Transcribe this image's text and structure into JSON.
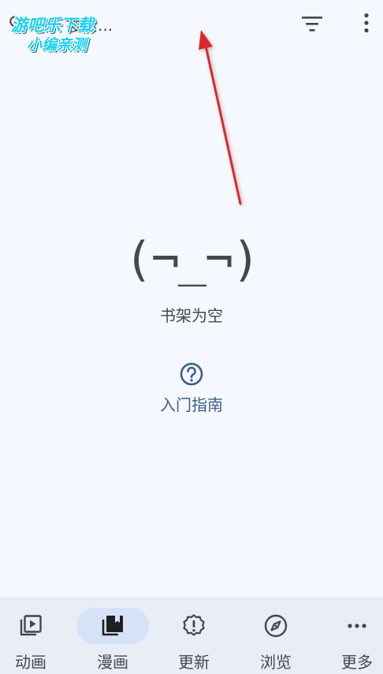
{
  "topbar": {
    "search_placeholder": "搜索...",
    "icons": [
      "search-icon",
      "filter-icon",
      "more-vert-icon"
    ]
  },
  "watermark": {
    "line1": "游吧乐下载",
    "line2": "小编亲测"
  },
  "empty_state": {
    "face": "(¬_¬)",
    "message": "书架为空",
    "guide_label": "入门指南",
    "guide_icon": "help-circle-icon"
  },
  "bottom_nav": {
    "items": [
      {
        "label": "动画",
        "icon": "play-library-icon",
        "active": false
      },
      {
        "label": "漫画",
        "icon": "book-library-icon",
        "active": true
      },
      {
        "label": "更新",
        "icon": "alert-badge-icon",
        "active": false
      },
      {
        "label": "浏览",
        "icon": "compass-icon",
        "active": false
      },
      {
        "label": "更多",
        "icon": "more-horiz-icon",
        "active": false
      }
    ]
  },
  "colors": {
    "background": "#f5f8fe",
    "nav_background": "#e8edf6",
    "active_pill": "#d6e3f7",
    "text": "#44474e",
    "link": "#3a5f8a",
    "annotation_arrow": "#e0252a",
    "watermark": "#1ad1f0"
  }
}
